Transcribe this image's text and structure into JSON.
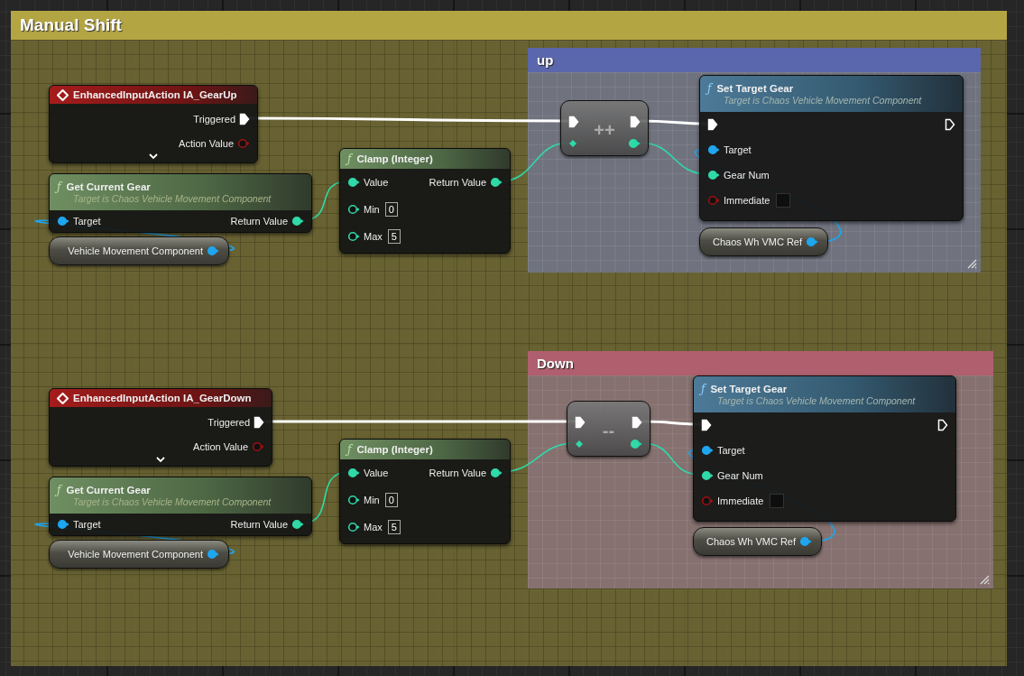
{
  "comment": {
    "title": "Manual Shift"
  },
  "sections": [
    {
      "group": {
        "title": "up",
        "color": "#5b67ac"
      },
      "event": {
        "title": "EnhancedInputAction IA_GearUp",
        "pins": [
          {
            "label": "Triggered",
            "kind": "exec",
            "output": true,
            "linked": true
          },
          {
            "label": "Action Value",
            "kind": "bool",
            "output": true,
            "linked": false
          }
        ]
      },
      "getter": {
        "glyph": "ƒ",
        "title": "Get Current Gear",
        "subtitle": "Target is Chaos Vehicle Movement Component",
        "pins": [
          {
            "label": "Target",
            "kind": "object",
            "output": false,
            "linked": true
          },
          {
            "label": "Return Value",
            "kind": "int",
            "output": true,
            "linked": true
          }
        ]
      },
      "variable": {
        "label": "Vehicle Movement Component",
        "kind": "object",
        "linked": true
      },
      "clamp": {
        "glyph": "ƒ",
        "title": "Clamp (Integer)",
        "pins": [
          {
            "label": "Value",
            "kind": "int",
            "output": false,
            "linked": true
          },
          {
            "label": "Min",
            "kind": "int",
            "output": false,
            "linked": false,
            "value": "0"
          },
          {
            "label": "Max",
            "kind": "int",
            "output": false,
            "linked": false,
            "value": "5"
          },
          {
            "label": "Return Value",
            "kind": "int",
            "output": true,
            "linked": true
          }
        ]
      },
      "operator": {
        "symbol": "++"
      },
      "setter": {
        "glyph": "ƒ",
        "title": "Set Target Gear",
        "subtitle": "Target is Chaos Vehicle Movement Component",
        "pins": [
          {
            "kind": "exec",
            "output": false,
            "linked": true
          },
          {
            "label": "Target",
            "kind": "object",
            "output": false,
            "linked": true
          },
          {
            "label": "Gear Num",
            "kind": "int",
            "output": false,
            "linked": true
          },
          {
            "label": "Immediate",
            "kind": "bool",
            "output": false,
            "linked": false,
            "checked": false
          },
          {
            "kind": "exec",
            "output": true,
            "linked": false
          }
        ]
      },
      "reference": {
        "label": "Chaos Wh VMC Ref",
        "kind": "object",
        "linked": true
      }
    },
    {
      "group": {
        "title": "Down",
        "color": "#b05f6f"
      },
      "event": {
        "title": "EnhancedInputAction IA_GearDown",
        "pins": [
          {
            "label": "Triggered",
            "kind": "exec",
            "output": true,
            "linked": true
          },
          {
            "label": "Action Value",
            "kind": "bool",
            "output": true,
            "linked": false
          }
        ]
      },
      "getter": {
        "glyph": "ƒ",
        "title": "Get Current Gear",
        "subtitle": "Target is Chaos Vehicle Movement Component",
        "pins": [
          {
            "label": "Target",
            "kind": "object",
            "output": false,
            "linked": true
          },
          {
            "label": "Return Value",
            "kind": "int",
            "output": true,
            "linked": true
          }
        ]
      },
      "variable": {
        "label": "Vehicle Movement Component",
        "kind": "object",
        "linked": true
      },
      "clamp": {
        "glyph": "ƒ",
        "title": "Clamp (Integer)",
        "pins": [
          {
            "label": "Value",
            "kind": "int",
            "output": false,
            "linked": true
          },
          {
            "label": "Min",
            "kind": "int",
            "output": false,
            "linked": false,
            "value": "0"
          },
          {
            "label": "Max",
            "kind": "int",
            "output": false,
            "linked": false,
            "value": "5"
          },
          {
            "label": "Return Value",
            "kind": "int",
            "output": true,
            "linked": true
          }
        ]
      },
      "operator": {
        "symbol": "--"
      },
      "setter": {
        "glyph": "ƒ",
        "title": "Set Target Gear",
        "subtitle": "Target is Chaos Vehicle Movement Component",
        "pins": [
          {
            "kind": "exec",
            "output": false,
            "linked": true
          },
          {
            "label": "Target",
            "kind": "object",
            "output": false,
            "linked": true
          },
          {
            "label": "Gear Num",
            "kind": "int",
            "output": false,
            "linked": true
          },
          {
            "label": "Immediate",
            "kind": "bool",
            "output": false,
            "linked": false,
            "checked": false
          },
          {
            "kind": "exec",
            "output": true,
            "linked": false
          }
        ]
      },
      "reference": {
        "label": "Chaos Wh VMC Ref",
        "kind": "object",
        "linked": true
      }
    }
  ]
}
